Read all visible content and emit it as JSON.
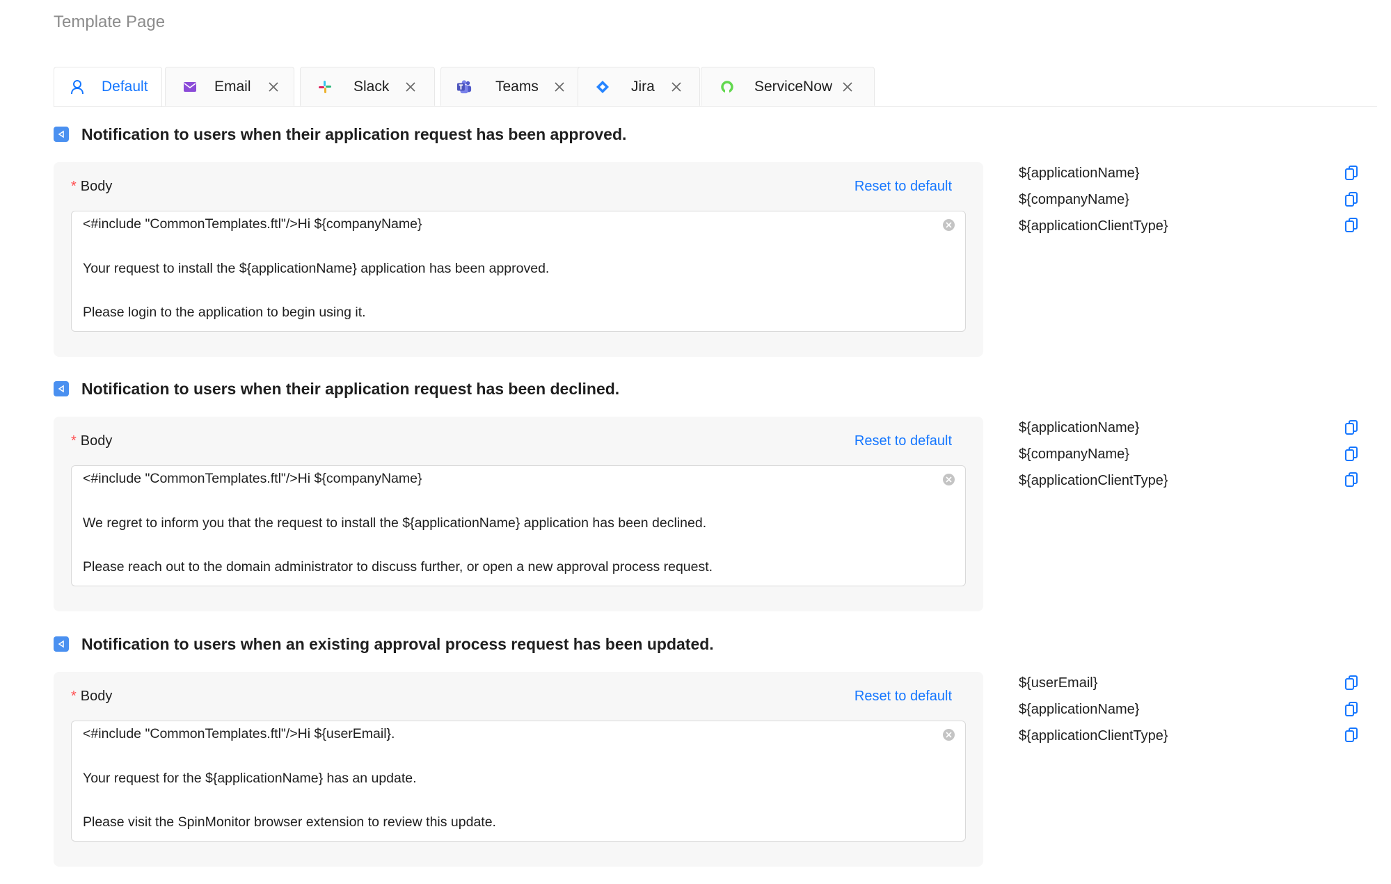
{
  "page": {
    "title": "Template Page"
  },
  "tabs": [
    {
      "label": "Default",
      "icon": "user-icon",
      "active": true
    },
    {
      "label": "Email",
      "icon": "mail-icon"
    },
    {
      "label": "Slack",
      "icon": "slack-icon"
    },
    {
      "label": "Teams",
      "icon": "teams-icon"
    },
    {
      "label": "Jira",
      "icon": "jira-icon"
    },
    {
      "label": "ServiceNow",
      "icon": "servicenow-icon"
    }
  ],
  "colors": {
    "accent": "#1677ff",
    "required": "#ff4d4f",
    "heading_icon": "#4a90f0"
  },
  "sections": [
    {
      "heading": "Notification to users when their application request has been approved.",
      "body_label": "Body",
      "required_mark": "*",
      "reset_label": "Reset to default",
      "lines": [
        "<#include \"CommonTemplates.ftl\"/>Hi ${companyName}",
        "Your request to install the ${applicationName} application has been approved.",
        "Please login to the application to begin using it."
      ],
      "variables": [
        "${applicationName}",
        "${companyName}",
        "${applicationClientType}"
      ]
    },
    {
      "heading": "Notification to users when their application request has been declined.",
      "body_label": "Body",
      "required_mark": "*",
      "reset_label": "Reset to default",
      "lines": [
        "<#include \"CommonTemplates.ftl\"/>Hi ${companyName}",
        "We regret to inform you that the request to install the ${applicationName} application has been declined.",
        "Please reach out to the domain administrator to discuss further, or open a new approval process request."
      ],
      "variables": [
        "${applicationName}",
        "${companyName}",
        "${applicationClientType}"
      ]
    },
    {
      "heading": "Notification to users when an existing approval process request has been updated.",
      "body_label": "Body",
      "required_mark": "*",
      "reset_label": "Reset to default",
      "lines": [
        "<#include \"CommonTemplates.ftl\"/>Hi ${userEmail}.",
        "Your request for the ${applicationName} has an update.",
        "Please visit the SpinMonitor browser extension to review this update."
      ],
      "variables": [
        "${userEmail}",
        "${applicationName}",
        "${applicationClientType}"
      ]
    }
  ]
}
